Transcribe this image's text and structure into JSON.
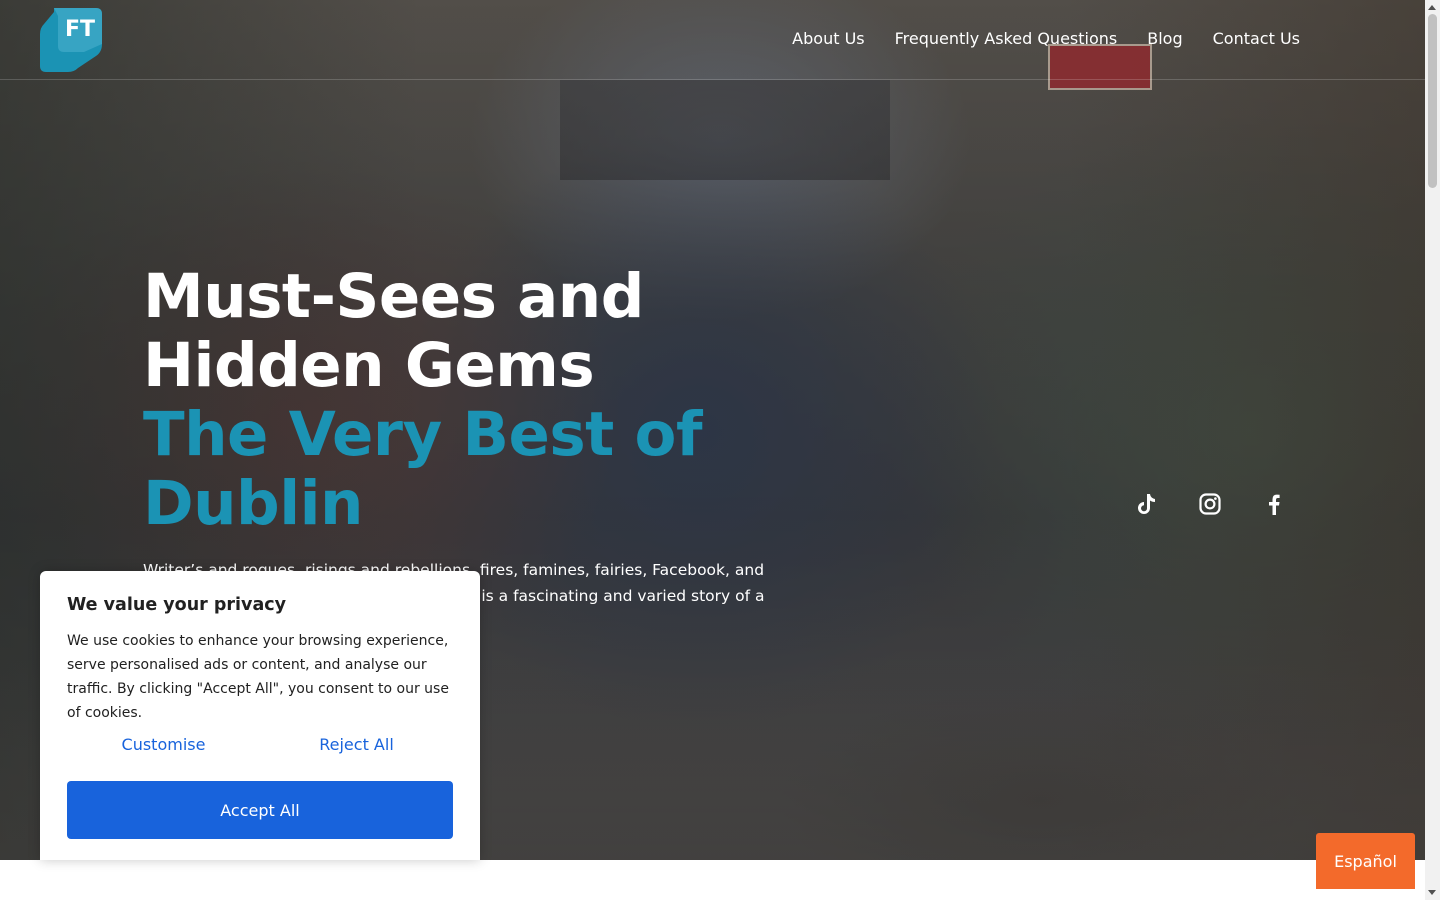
{
  "header": {
    "logo_text": "FT",
    "nav": [
      {
        "label": "About Us"
      },
      {
        "label": "Frequently Asked Questions"
      },
      {
        "label": "Blog"
      },
      {
        "label": "Contact Us"
      }
    ]
  },
  "hero": {
    "headline_line1": "Must-Sees and",
    "headline_line2": "Hidden Gems",
    "accent_line1": "The Very Best of",
    "accent_line2": "Dublin",
    "intro_line1": "Writer’s and rogues, risings and rebellions, fires, famines, fairies, Facebook, and",
    "intro_line2": "lin is a fascinating and varied story of a",
    "accent_color": "#1b93b4"
  },
  "social": {
    "icons": [
      "tiktok-icon",
      "instagram-icon",
      "facebook-icon"
    ]
  },
  "cookie_banner": {
    "title": "We value your privacy",
    "body": "We use cookies to enhance your browsing experience, serve personalised ads or content, and analyse our traffic. By clicking \"Accept All\", you consent to our use of cookies.",
    "customise_label": "Customise",
    "reject_label": "Reject All",
    "accept_label": "Accept All",
    "accent_color": "#1863dc"
  },
  "language_button": {
    "label": "Español",
    "color": "#f36a2b"
  }
}
